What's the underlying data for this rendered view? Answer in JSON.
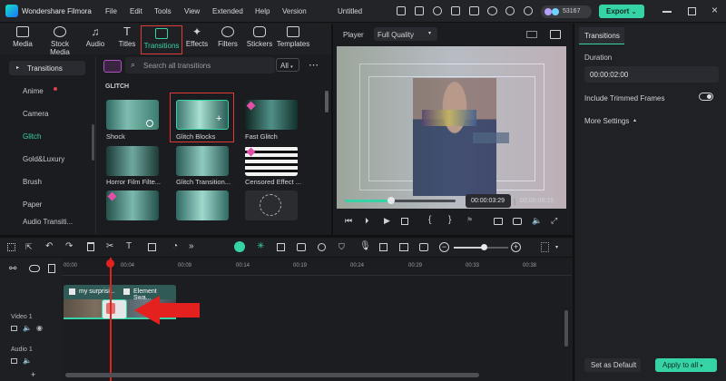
{
  "app": {
    "name": "Wondershare Filmora",
    "project_title": "Untitled",
    "credits": "53167",
    "export_label": "Export"
  },
  "menu": [
    "File",
    "Edit",
    "Tools",
    "View",
    "Extended",
    "Help",
    "Version"
  ],
  "top_tabs": [
    {
      "label": "Media",
      "icon": "media-icon"
    },
    {
      "label": "Stock Media",
      "icon": "stock-media-icon"
    },
    {
      "label": "Audio",
      "icon": "audio-icon"
    },
    {
      "label": "Titles",
      "icon": "titles-icon"
    },
    {
      "label": "Transitions",
      "icon": "transitions-icon",
      "active": true
    },
    {
      "label": "Effects",
      "icon": "effects-icon"
    },
    {
      "label": "Filters",
      "icon": "filters-icon"
    },
    {
      "label": "Stickers",
      "icon": "stickers-icon"
    },
    {
      "label": "Templates",
      "icon": "templates-icon"
    }
  ],
  "left_nav": {
    "header": "Transitions",
    "items": [
      "Anime",
      "Camera",
      "Glitch",
      "Gold&Luxury",
      "Brush",
      "Paper",
      "Audio Transiti..."
    ],
    "selected": "Glitch"
  },
  "library": {
    "search_placeholder": "Search all transitions",
    "filter": "All",
    "section": "GLITCH",
    "items": [
      {
        "label": "Shock"
      },
      {
        "label": "Glitch Blocks",
        "selected": true
      },
      {
        "label": "Fast Glitch"
      },
      {
        "label": "Horror Film Filte..."
      },
      {
        "label": "Glitch Transition..."
      },
      {
        "label": "Censored Effect ..."
      },
      {
        "label": ""
      },
      {
        "label": ""
      },
      {
        "label": ""
      }
    ]
  },
  "player": {
    "label": "Player",
    "quality": "Full Quality",
    "current_time": "00:00:03:29",
    "total_time": "00:00:09:15",
    "progress": 0.42
  },
  "properties": {
    "tab": "Transitions",
    "duration_label": "Duration",
    "duration_value": "00:00:02:00",
    "include_trimmed_label": "Include Trimmed Frames",
    "more_settings_label": "More Settings",
    "set_default_label": "Set as Default",
    "apply_all_label": "Apply to all"
  },
  "timeline": {
    "ruler": [
      "00:00",
      "00:04",
      "00:09",
      "00:14",
      "00:19",
      "00:24",
      "00:29",
      "00:33",
      "00:38"
    ],
    "tracks": [
      {
        "label": "Video 1"
      },
      {
        "label": "Audio 1"
      }
    ],
    "clips": [
      {
        "label": "my surprisi..."
      },
      {
        "label": "Element Swa..."
      }
    ],
    "zoom_level": 0.55
  },
  "colors": {
    "accent": "#36d3a7",
    "highlight": "#e03a3a",
    "clip": "#2f5a56"
  }
}
